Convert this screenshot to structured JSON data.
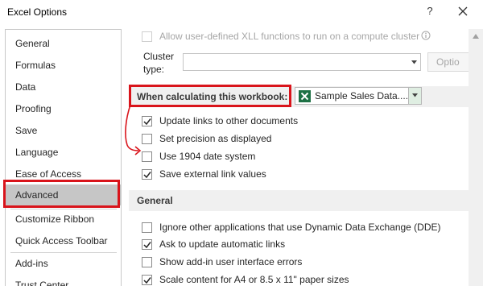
{
  "window": {
    "title": "Excel Options",
    "help_glyph": "?"
  },
  "nav": {
    "items": [
      {
        "label": "General"
      },
      {
        "label": "Formulas"
      },
      {
        "label": "Data"
      },
      {
        "label": "Proofing"
      },
      {
        "label": "Save"
      },
      {
        "label": "Language"
      },
      {
        "label": "Ease of Access"
      },
      {
        "label": "Advanced"
      },
      {
        "label": "Customize Ribbon"
      },
      {
        "label": "Quick Access Toolbar"
      },
      {
        "label": "Add-ins"
      },
      {
        "label": "Trust Center"
      }
    ],
    "selected": "Advanced"
  },
  "cluster": {
    "allow_xll_label": "Allow user-defined XLL functions to run on a compute cluster",
    "cluster_type_label_1": "Cluster",
    "cluster_type_label_2": "type:",
    "cluster_type_value": "",
    "options_button_label": "Optio"
  },
  "workbook_section": {
    "header_label": "When calculating this workbook:",
    "workbook_value": "Sample Sales Data....",
    "options": [
      {
        "label": "Update links to other documents",
        "checked": true
      },
      {
        "label": "Set precision as displayed",
        "checked": false
      },
      {
        "label": "Use 1904 date system",
        "checked": false
      },
      {
        "label": "Save external link values",
        "checked": true
      }
    ]
  },
  "general_section": {
    "header_label": "General",
    "options": [
      {
        "label": "Ignore other applications that use Dynamic Data Exchange (DDE)",
        "checked": false
      },
      {
        "label": "Ask to update automatic links",
        "checked": true
      },
      {
        "label": "Show add-in user interface errors",
        "checked": false
      },
      {
        "label": "Scale content for A4 or 8.5 x 11\" paper sizes",
        "checked": true
      }
    ]
  },
  "colors": {
    "highlight_red": "#d9141b",
    "excel_green": "#1e7145",
    "selected_nav": "#c6c6c6"
  }
}
